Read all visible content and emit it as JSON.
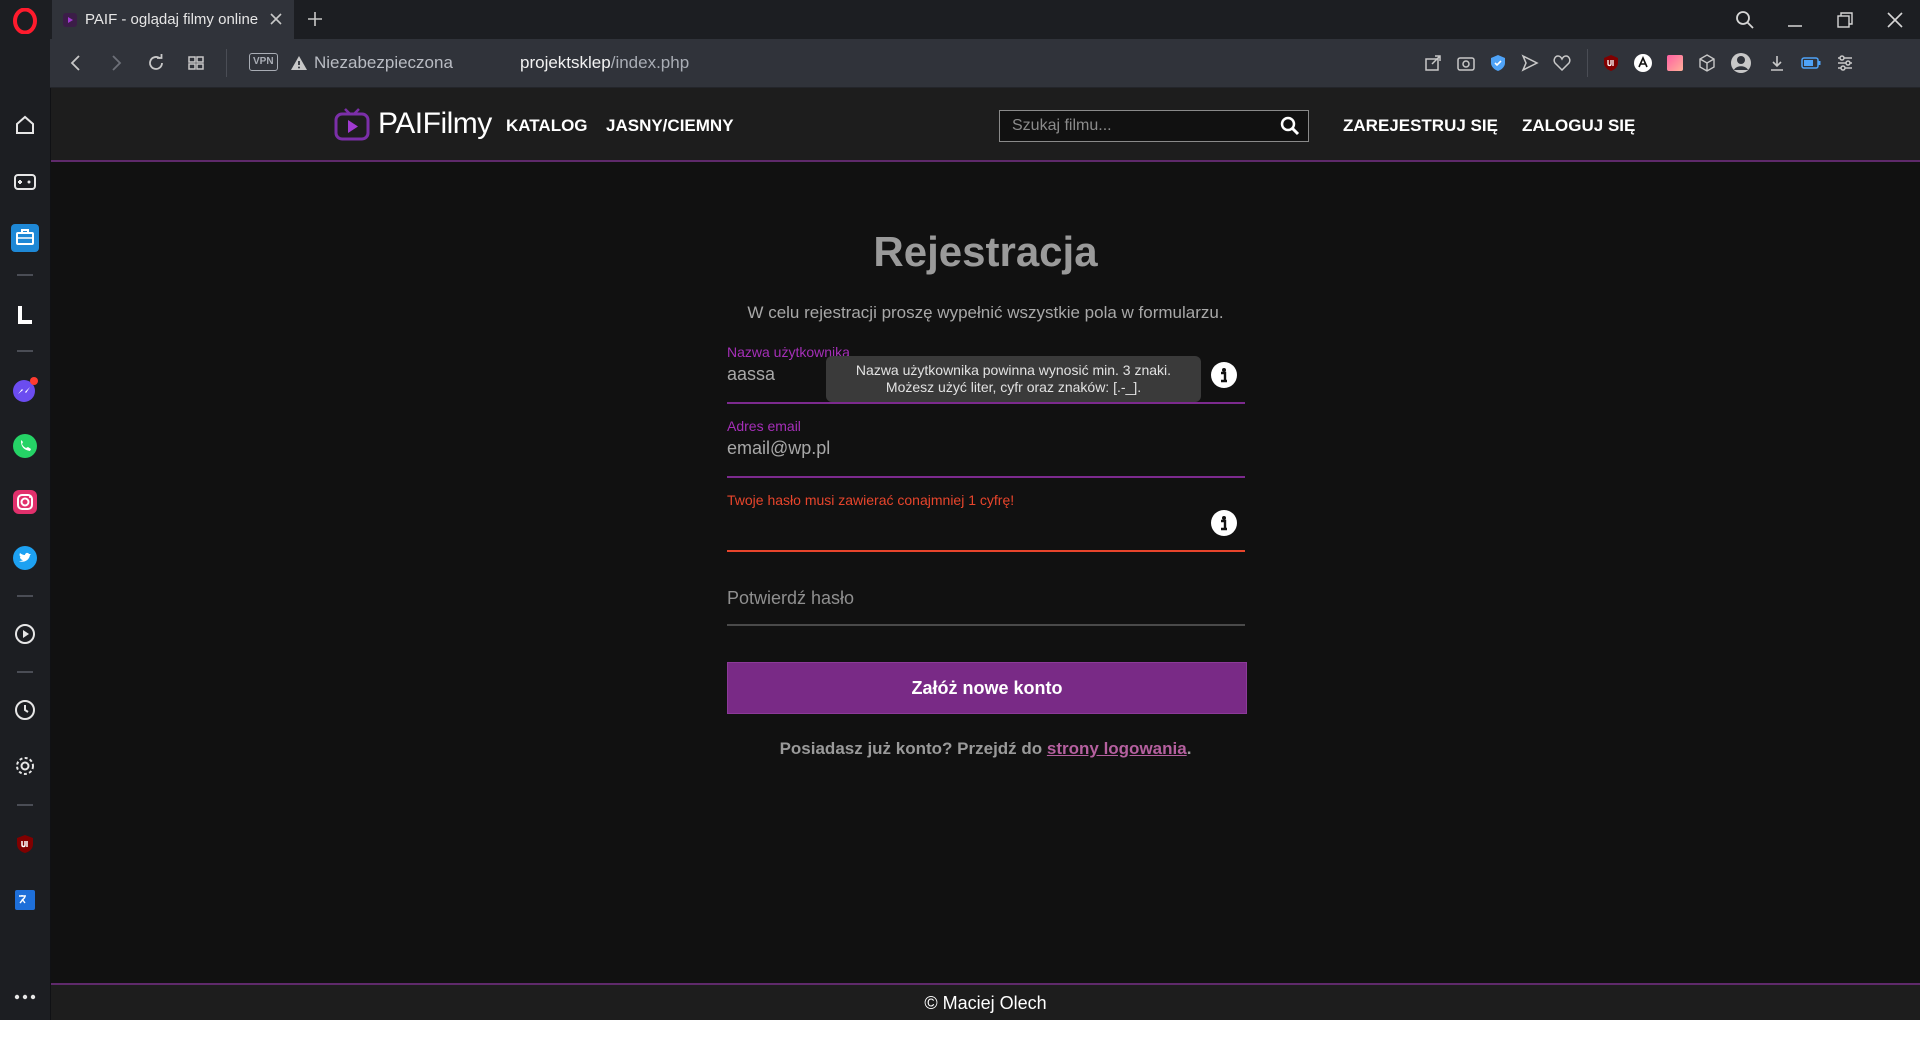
{
  "browser": {
    "tab_title": "PAIF - oglądaj filmy online",
    "security_label": "Niezabezpieczona",
    "vpn_label": "VPN",
    "url_host": "projektsklep",
    "url_path": "/index.php"
  },
  "site": {
    "logo_text": "PAIFilmy",
    "nav": {
      "catalog": "KATALOG",
      "theme_light": "JASNY/",
      "theme_dark": "CIEMNY",
      "register": "ZAREJESTRUJ SIĘ",
      "login": "ZALOGUJ SIĘ"
    },
    "search": {
      "placeholder": "Szukaj filmu..."
    },
    "colors": {
      "accent": "#792a86",
      "error": "#e8452c",
      "label": "#a52fb8"
    }
  },
  "form": {
    "title": "Rejestracja",
    "subtitle": "W celu rejestracji proszę wypełnić wszystkie pola w formularzu.",
    "username": {
      "label": "Nazwa użytkownika",
      "value": "aassa"
    },
    "tooltip": {
      "line1": "Nazwa użytkownika powinna wynosić min. 3 znaki.",
      "line2": "Możesz użyć liter, cyfr oraz znaków: [.-_]."
    },
    "email": {
      "label": "Adres email",
      "value": "email@wp.pl"
    },
    "password": {
      "error": "Twoje hasło musi zawierać conajmniej 1 cyfrę!"
    },
    "confirm": {
      "placeholder": "Potwierdź hasło"
    },
    "submit_label": "Załóż nowe konto",
    "login_prompt": "Posiadasz już konto? Przejdź do ",
    "login_link": "strony logowania",
    "login_suffix": "."
  },
  "footer": {
    "text": "© Maciej Olech"
  }
}
